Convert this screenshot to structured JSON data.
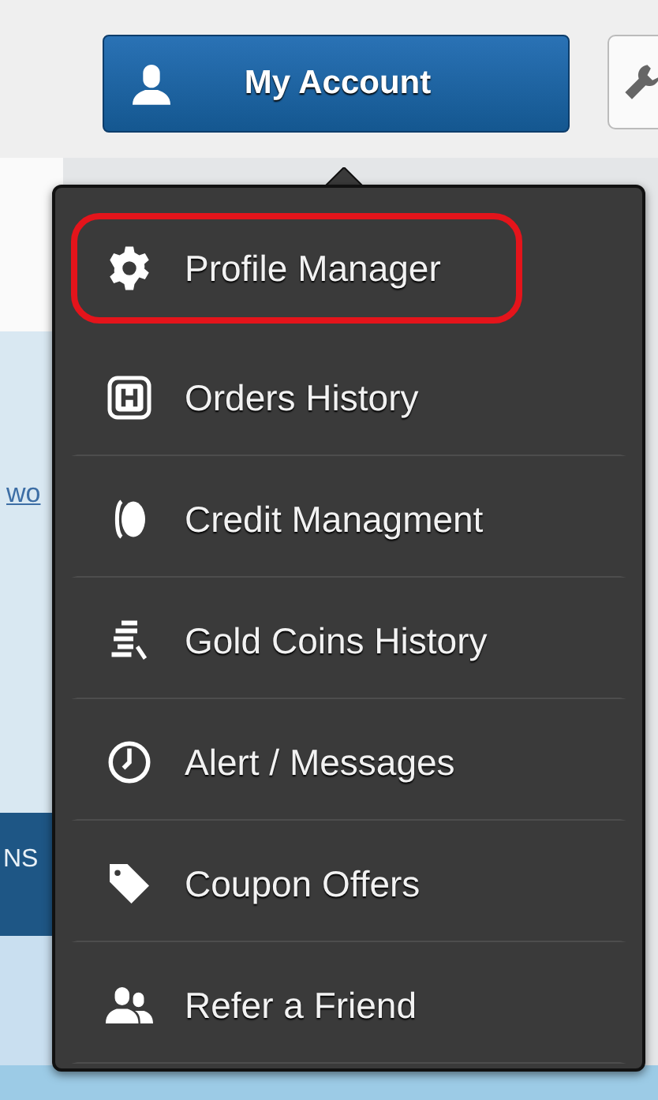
{
  "header": {
    "account_button": "My Account"
  },
  "background": {
    "link_fragment": "wo",
    "band_fragment": "NS"
  },
  "menu": {
    "items": [
      {
        "kind": "gear",
        "label": "Profile Manager",
        "highlighted": true
      },
      {
        "kind": "history",
        "label": "Orders History",
        "highlighted": false
      },
      {
        "kind": "coin",
        "label": "Credit Managment",
        "highlighted": false
      },
      {
        "kind": "coins",
        "label": "Gold Coins History",
        "highlighted": false
      },
      {
        "kind": "clock",
        "label": "Alert / Messages",
        "highlighted": false
      },
      {
        "kind": "tag",
        "label": "Coupon Offers",
        "highlighted": false
      },
      {
        "kind": "people",
        "label": "Refer a Friend",
        "highlighted": false
      }
    ]
  }
}
